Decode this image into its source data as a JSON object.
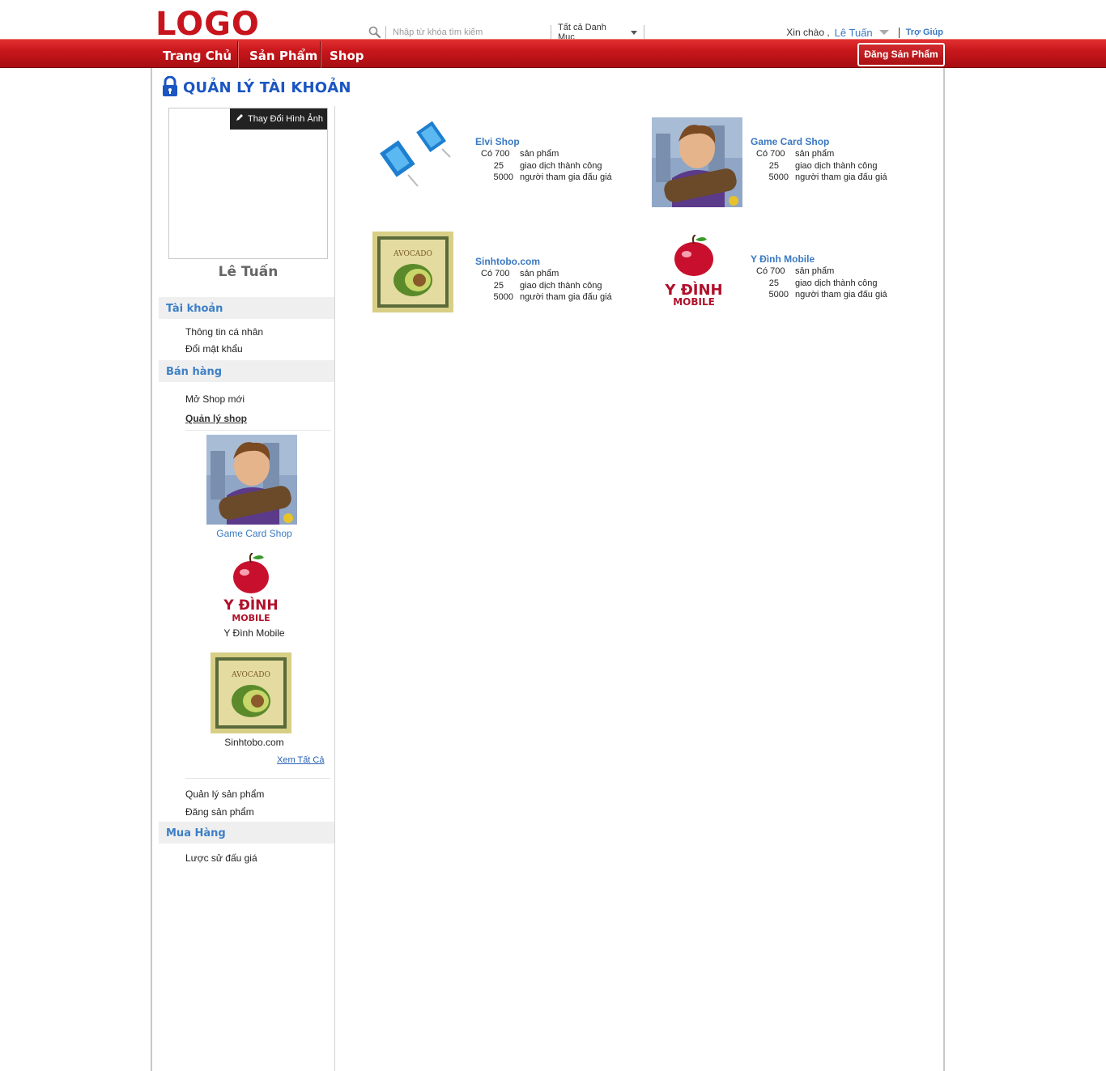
{
  "header": {
    "logo": "LOGO",
    "search_placeholder": "Nhập từ khóa tìm kiếm",
    "category_label": "Tất cả Danh Mục",
    "greeting": "Xin chào ,",
    "user_name": "Lê Tuấn",
    "help": "Trợ Giúp"
  },
  "nav": {
    "items": [
      "Trang Chủ",
      "Sản Phẩm",
      "Shop"
    ],
    "post_button": "Đăng Sản Phẩm"
  },
  "page": {
    "title": "QUẢN LÝ TÀI KHOẢN"
  },
  "profile": {
    "change_image": "Thay Đổi Hình Ảnh",
    "name": "Lê Tuấn"
  },
  "sidebar": {
    "account": {
      "heading": "Tài khoản",
      "links": [
        "Thông tin cá nhân",
        "Đổi mật khẩu"
      ]
    },
    "selling": {
      "heading": "Bán hàng",
      "links": [
        "Mở Shop mới",
        "Quản lý shop"
      ],
      "shops": [
        "Game Card Shop",
        "Y Đình Mobile",
        "Sinhtobo.com"
      ],
      "see_all": "Xem Tất Cả",
      "links_after": [
        "Quản lý sản phẩm",
        "Đăng sản phẩm"
      ]
    },
    "buying": {
      "heading": "Mua Hàng",
      "links": [
        "Lược sử đấu giá"
      ]
    }
  },
  "shops": [
    {
      "name": "Elvi Shop",
      "prefix": "Có 700",
      "products_label": "sản phẩm",
      "deals": "25",
      "deals_label": "giao dịch thành công",
      "bidders": "5000",
      "bidders_label": "người tham gia đấu giá"
    },
    {
      "name": "Game Card Shop",
      "prefix": "Có 700",
      "products_label": "sản phẩm",
      "deals": "25",
      "deals_label": "giao dịch thành công",
      "bidders": "5000",
      "bidders_label": "người tham gia đấu giá"
    },
    {
      "name": "Sinhtobo.com",
      "prefix": "Có 700",
      "products_label": "sản phẩm",
      "deals": "25",
      "deals_label": "giao dịch thành công",
      "bidders": "5000",
      "bidders_label": "người tham gia đấu giá"
    },
    {
      "name": "Y Đình Mobile",
      "prefix": "Có 700",
      "products_label": "sản phẩm",
      "deals": "25",
      "deals_label": "giao dịch thành công",
      "bidders": "5000",
      "bidders_label": "người tham gia đấu giá"
    }
  ],
  "logo_texts": {
    "ydinh_line1": "Y ĐÌNH",
    "ydinh_line2": "MOBILE",
    "avocado": "AVOCADO"
  },
  "colors": {
    "brand_red": "#c8151d",
    "link_blue": "#3a79c1",
    "title_blue": "#1b56c2"
  },
  "icons": [
    "search-icon",
    "chevron-down-icon",
    "lock-icon",
    "pencil-icon"
  ]
}
